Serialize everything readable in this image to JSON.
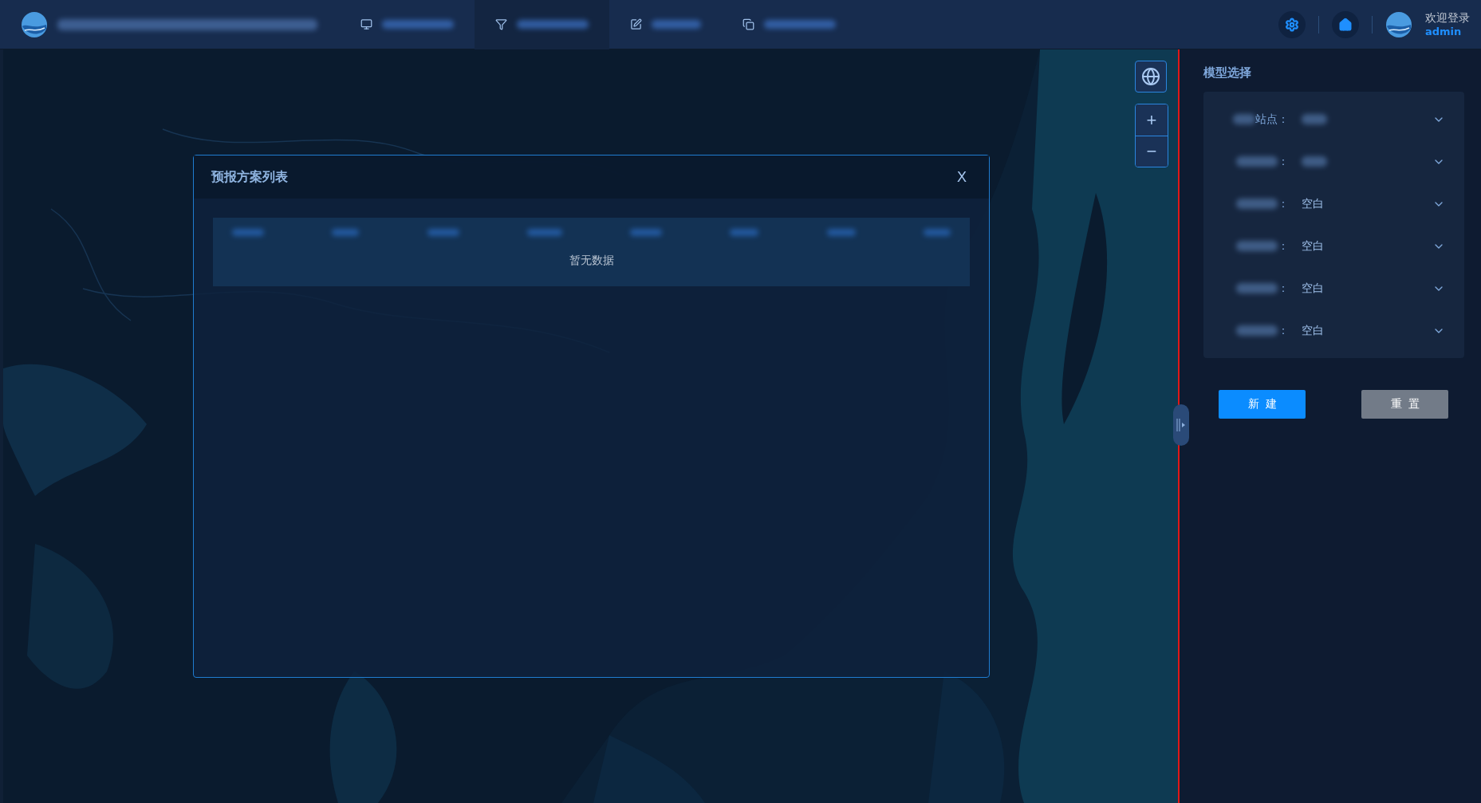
{
  "header": {
    "title_redacted": true,
    "welcome": "欢迎登录",
    "user": "admin"
  },
  "nav_tabs": [
    {
      "selected": false
    },
    {
      "selected": true
    },
    {
      "selected": false
    },
    {
      "selected": false
    }
  ],
  "map_controls": {
    "zoom_in": "+",
    "zoom_out": "−"
  },
  "dialog": {
    "title": "预报方案列表",
    "close": "X",
    "empty_text": "暂无数据"
  },
  "panel": {
    "title": "模型选择",
    "fields": [
      {
        "label": "站点：",
        "label_redacted": true,
        "value_redacted": true
      },
      {
        "label": "：",
        "label_redacted": true,
        "value_redacted": true
      },
      {
        "label": "：",
        "label_redacted": true,
        "value": "空白"
      },
      {
        "label": "：",
        "label_redacted": true,
        "value": "空白"
      },
      {
        "label": "：",
        "label_redacted": true,
        "value": "空白"
      },
      {
        "label": "：",
        "label_redacted": true,
        "value": "空白"
      }
    ],
    "buttons": [
      {
        "label": "新建",
        "kind": "primary"
      },
      {
        "label": "重置",
        "kind": "secondary"
      }
    ]
  }
}
